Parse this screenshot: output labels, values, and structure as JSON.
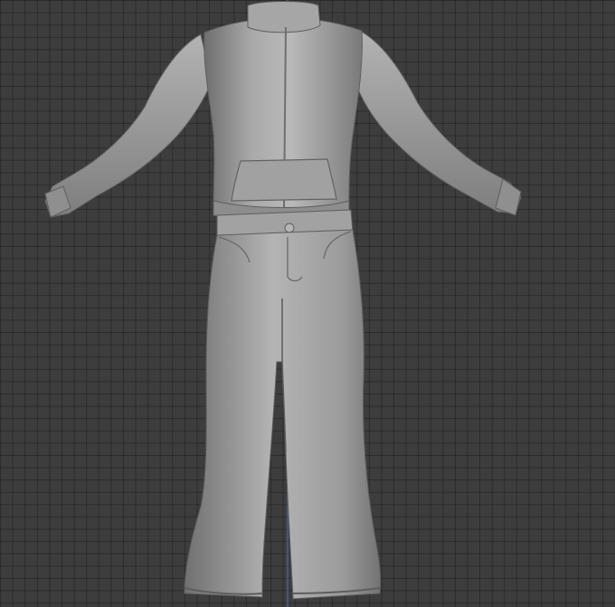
{
  "viewport": {
    "background": "#3d3d3d",
    "grid_color": "#2e2e2e",
    "axis_color": "#3f6fa8",
    "grid_visible": true,
    "shading": "solid"
  },
  "model": {
    "material_base": "#9a9a9a",
    "material_highlight": "#c2c2c2",
    "material_shadow": "#6a6a6a",
    "parts": [
      "jacket",
      "pants"
    ]
  }
}
